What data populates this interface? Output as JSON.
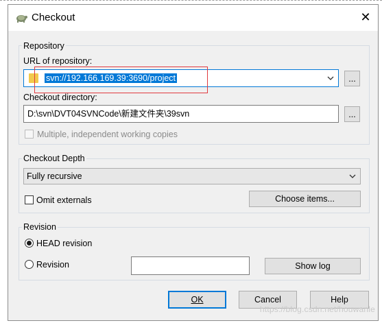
{
  "window": {
    "title": "Checkout",
    "icon": "tortoise-svn-icon",
    "close_glyph": "✕"
  },
  "repository": {
    "group_label": "Repository",
    "url_label": "URL of repository:",
    "url_value": "svn://192.166.169.39:3690/project",
    "url_browse": "...",
    "dir_label": "Checkout directory:",
    "dir_value": "D:\\svn\\DVT04SVNCode\\新建文件夹\\39svn",
    "dir_browse": "...",
    "multiple_label": "Multiple, independent working copies",
    "multiple_checked": false
  },
  "depth": {
    "group_label": "Checkout Depth",
    "selected": "Fully recursive",
    "omit_externals_label": "Omit externals",
    "omit_externals_checked": false,
    "choose_items": "Choose items..."
  },
  "revision": {
    "group_label": "Revision",
    "head_label": "HEAD revision",
    "revision_label": "Revision",
    "selected": "HEAD revision",
    "revision_value": "",
    "show_log": "Show log"
  },
  "buttons": {
    "ok": "OK",
    "cancel": "Cancel",
    "help": "Help"
  },
  "watermark": "https://blog.csdn.net/houwanle",
  "colors": {
    "accent": "#0078d7",
    "highlight_box": "#e0393e",
    "folder": "#f2c94c"
  }
}
